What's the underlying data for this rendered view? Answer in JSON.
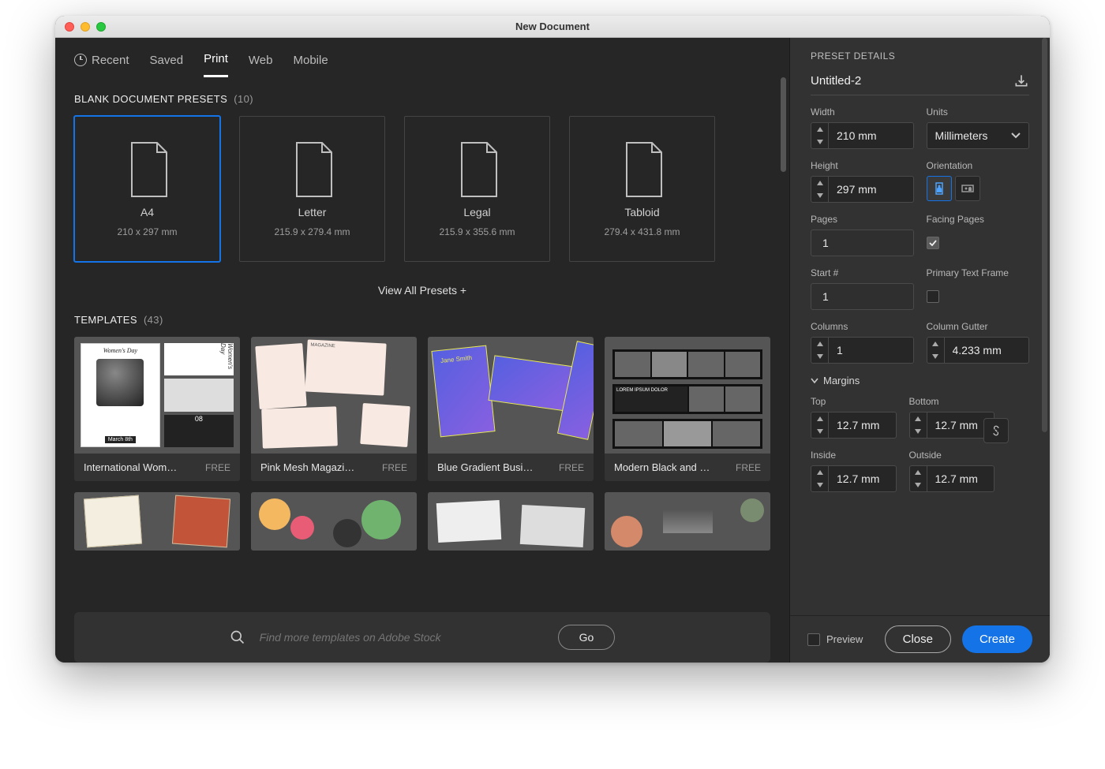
{
  "window": {
    "title": "New Document"
  },
  "tabs": {
    "recent": "Recent",
    "saved": "Saved",
    "print": "Print",
    "web": "Web",
    "mobile": "Mobile",
    "active": "print"
  },
  "sections": {
    "presets_label": "BLANK DOCUMENT PRESETS",
    "presets_count": "(10)",
    "view_all": "View All Presets +",
    "templates_label": "TEMPLATES",
    "templates_count": "(43)"
  },
  "presets": [
    {
      "name": "A4",
      "dims": "210 x 297 mm",
      "selected": true
    },
    {
      "name": "Letter",
      "dims": "215.9 x 279.4 mm",
      "selected": false
    },
    {
      "name": "Legal",
      "dims": "215.9 x 355.6 mm",
      "selected": false
    },
    {
      "name": "Tabloid",
      "dims": "279.4 x 431.8 mm",
      "selected": false
    }
  ],
  "templates": [
    {
      "name": "International Wome…",
      "price": "FREE"
    },
    {
      "name": "Pink Mesh Magazine…",
      "price": "FREE"
    },
    {
      "name": "Blue Gradient Busine…",
      "price": "FREE"
    },
    {
      "name": "Modern Black and W…",
      "price": "FREE"
    }
  ],
  "search": {
    "placeholder": "Find more templates on Adobe Stock",
    "go": "Go"
  },
  "panel": {
    "heading": "PRESET DETAILS",
    "docname": "Untitled-2",
    "labels": {
      "width": "Width",
      "units": "Units",
      "height": "Height",
      "orientation": "Orientation",
      "pages": "Pages",
      "facing": "Facing Pages",
      "start": "Start #",
      "ptf": "Primary Text Frame",
      "columns": "Columns",
      "gutter": "Column Gutter",
      "margins": "Margins",
      "top": "Top",
      "bottom": "Bottom",
      "inside": "Inside",
      "outside": "Outside",
      "preview": "Preview"
    },
    "values": {
      "width": "210 mm",
      "height": "297 mm",
      "units": "Millimeters",
      "pages": "1",
      "start": "1",
      "columns": "1",
      "gutter": "4.233 mm",
      "top": "12.7 mm",
      "bottom": "12.7 mm",
      "inside": "12.7 mm",
      "outside": "12.7 mm",
      "facing_checked": true,
      "ptf_checked": false,
      "orientation": "portrait"
    },
    "buttons": {
      "close": "Close",
      "create": "Create"
    }
  }
}
